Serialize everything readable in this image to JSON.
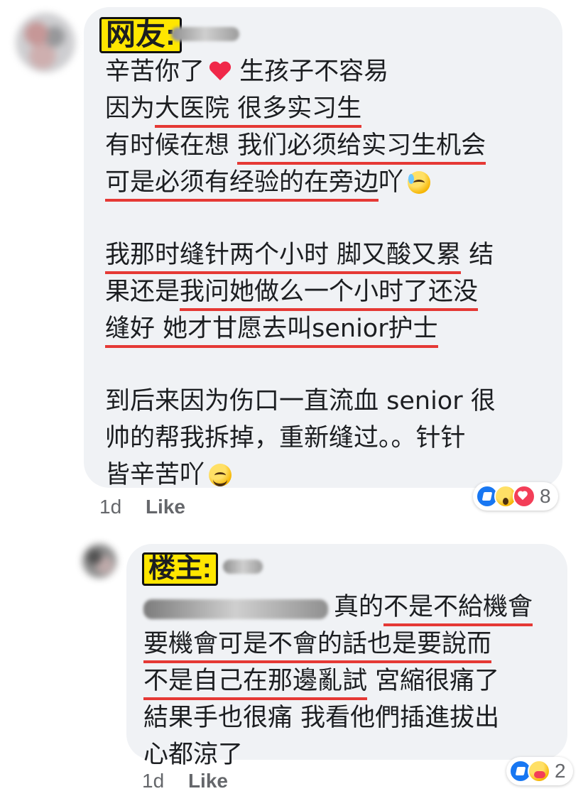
{
  "main_comment": {
    "name_tag": "网友:",
    "lines": [
      [
        {
          "text": "辛苦你了",
          "underline": false
        },
        {
          "emoji": "heart-icon"
        },
        {
          "text": " 生孩子不容易",
          "underline": false
        }
      ],
      [
        {
          "text": "因为",
          "underline": false
        },
        {
          "text": "大医院 很多实习生",
          "underline": true
        }
      ],
      [
        {
          "text": "有时候在想 ",
          "underline": false
        },
        {
          "text": "我们必须给实习生机会",
          "underline": true
        }
      ],
      [
        {
          "text": "可是必须有经验的在旁边",
          "underline": true
        },
        {
          "text": "吖",
          "underline": false
        },
        {
          "emoji": "anxious-sweat-icon"
        }
      ],
      [
        {
          "text": "我那时缝针两个小时 脚又酸又累",
          "underline": true
        },
        {
          "text": " 结",
          "underline": false
        }
      ],
      [
        {
          "text": "果还是",
          "underline": false
        },
        {
          "text": "我问她做么一个小时了还没",
          "underline": true
        }
      ],
      [
        {
          "text": "缝好 她才甘愿去叫senior护士",
          "underline": true
        }
      ],
      [
        {
          "text": "到后来因为伤口一直流血 senior 很",
          "underline": false
        }
      ],
      [
        {
          "text": "帅的帮我拆掉，重新缝过。。针针",
          "underline": false
        }
      ],
      [
        {
          "text": "皆辛苦吖",
          "underline": false
        },
        {
          "emoji": "loudly-crying-icon"
        }
      ]
    ],
    "meta": {
      "time": "1d",
      "like": "Like"
    },
    "reactions": {
      "icons": [
        "like-icon",
        "wow-icon",
        "love-icon"
      ],
      "count": "8"
    }
  },
  "reply_comment": {
    "name_tag": "楼主:",
    "lines": [
      [
        {
          "blur": true
        },
        {
          "text": "真的",
          "underline": false
        },
        {
          "text": "不是不給機會",
          "underline": true
        }
      ],
      [
        {
          "text": "要機會可是不會的話也是要說而",
          "underline": true
        }
      ],
      [
        {
          "text": "不是自己在那邊亂試",
          "underline": true
        },
        {
          "text": " 宮縮很痛了",
          "underline": false
        }
      ],
      [
        {
          "text": "結果手也很痛 我看他們插進拔出",
          "underline": false
        }
      ],
      [
        {
          "text": "心都涼了",
          "underline": false
        }
      ]
    ],
    "meta": {
      "time": "1d",
      "like": "Like"
    },
    "reactions": {
      "icons": [
        "like-icon",
        "care-icon"
      ],
      "count": "2"
    }
  }
}
